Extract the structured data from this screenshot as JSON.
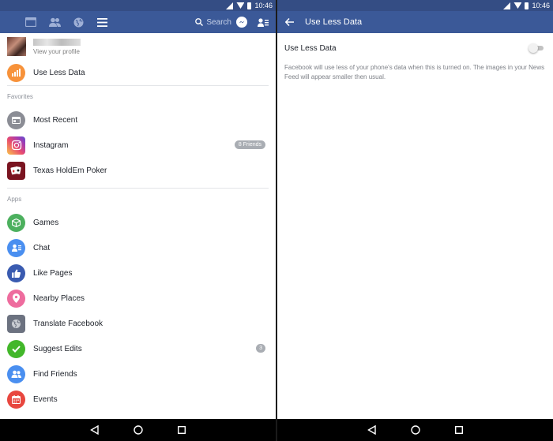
{
  "status_bar": {
    "time": "10:46"
  },
  "left_pane": {
    "search_placeholder": "Search",
    "profile": {
      "subtitle": "View your profile"
    },
    "top_item": {
      "label": "Use Less Data"
    },
    "favorites_header": "Favorites",
    "favorites": [
      {
        "label": "Most Recent"
      },
      {
        "label": "Instagram",
        "badge": "8 Friends"
      },
      {
        "label": "Texas HoldEm Poker"
      }
    ],
    "apps_header": "Apps",
    "apps": [
      {
        "label": "Games"
      },
      {
        "label": "Chat"
      },
      {
        "label": "Like Pages"
      },
      {
        "label": "Nearby Places"
      },
      {
        "label": "Translate Facebook"
      },
      {
        "label": "Suggest Edits",
        "badge": "3"
      },
      {
        "label": "Find Friends"
      },
      {
        "label": "Events"
      }
    ]
  },
  "right_pane": {
    "title": "Use Less Data",
    "setting_label": "Use Less Data",
    "toggle_on": false,
    "description": "Facebook will use less of your phone's data when this is turned on. The images in your News Feed will appear smaller then usual."
  },
  "colors": {
    "facebook_blue": "#3b5998",
    "status_bar": "#344d84",
    "orange": "#f7923a",
    "grey": "#8b8d95",
    "green": "#4cb05e",
    "blue": "#4a8ff0",
    "dark_blue": "#3a5bb0",
    "pink": "#ee6c9e",
    "check_green": "#42b72a",
    "red": "#e8473f"
  }
}
